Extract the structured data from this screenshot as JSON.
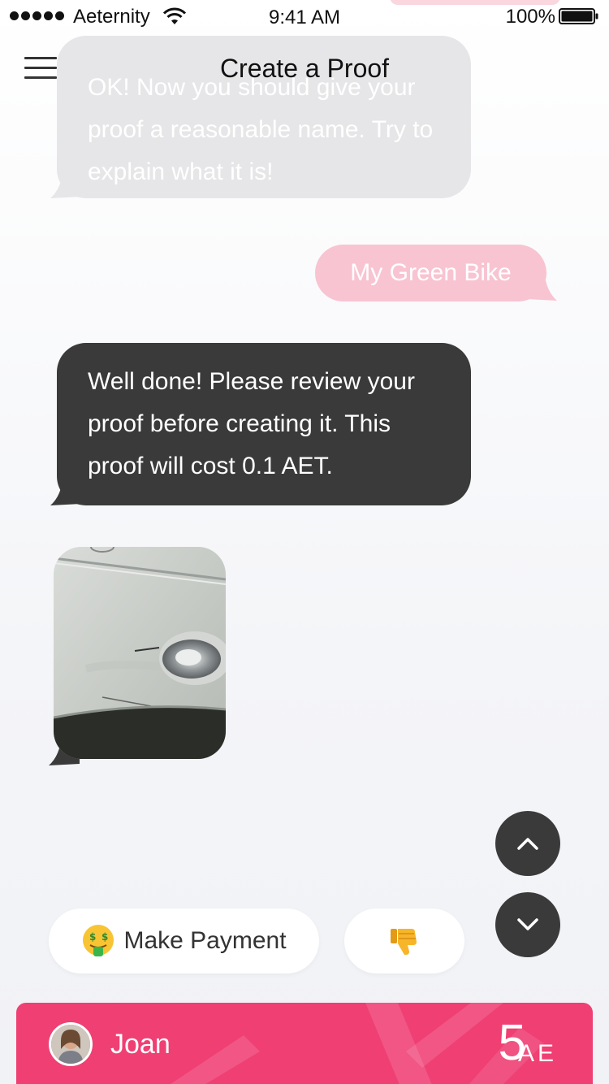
{
  "status_bar": {
    "carrier": "Aeternity",
    "time": "9:41 AM",
    "battery": "100%"
  },
  "nav": {
    "title": "Create a Proof"
  },
  "messages": [
    {
      "from": "bot",
      "text": "OK! Now you should give your proof a reasonable name. Try to explain what it is!"
    },
    {
      "from": "user",
      "text": "My Green Bike"
    },
    {
      "from": "bot",
      "text": "Well done! Please review your proof before creating it. This proof will cost 0.1 AET."
    },
    {
      "from": "bot",
      "type": "image",
      "image": "car-bumper-photo"
    }
  ],
  "quick_replies": {
    "payment": {
      "emoji": "money-mouth-face-icon",
      "label": "Make Payment"
    },
    "reject": {
      "emoji": "thumbs-down-icon"
    }
  },
  "account": {
    "name": "Joan",
    "balance": "5",
    "unit": "AE"
  },
  "colors": {
    "accent": "#ef3f73",
    "user_bubble": "#f8c4d2",
    "bot_bubble": "#3a3a3a",
    "faded_bubble": "#e6e6e8"
  }
}
